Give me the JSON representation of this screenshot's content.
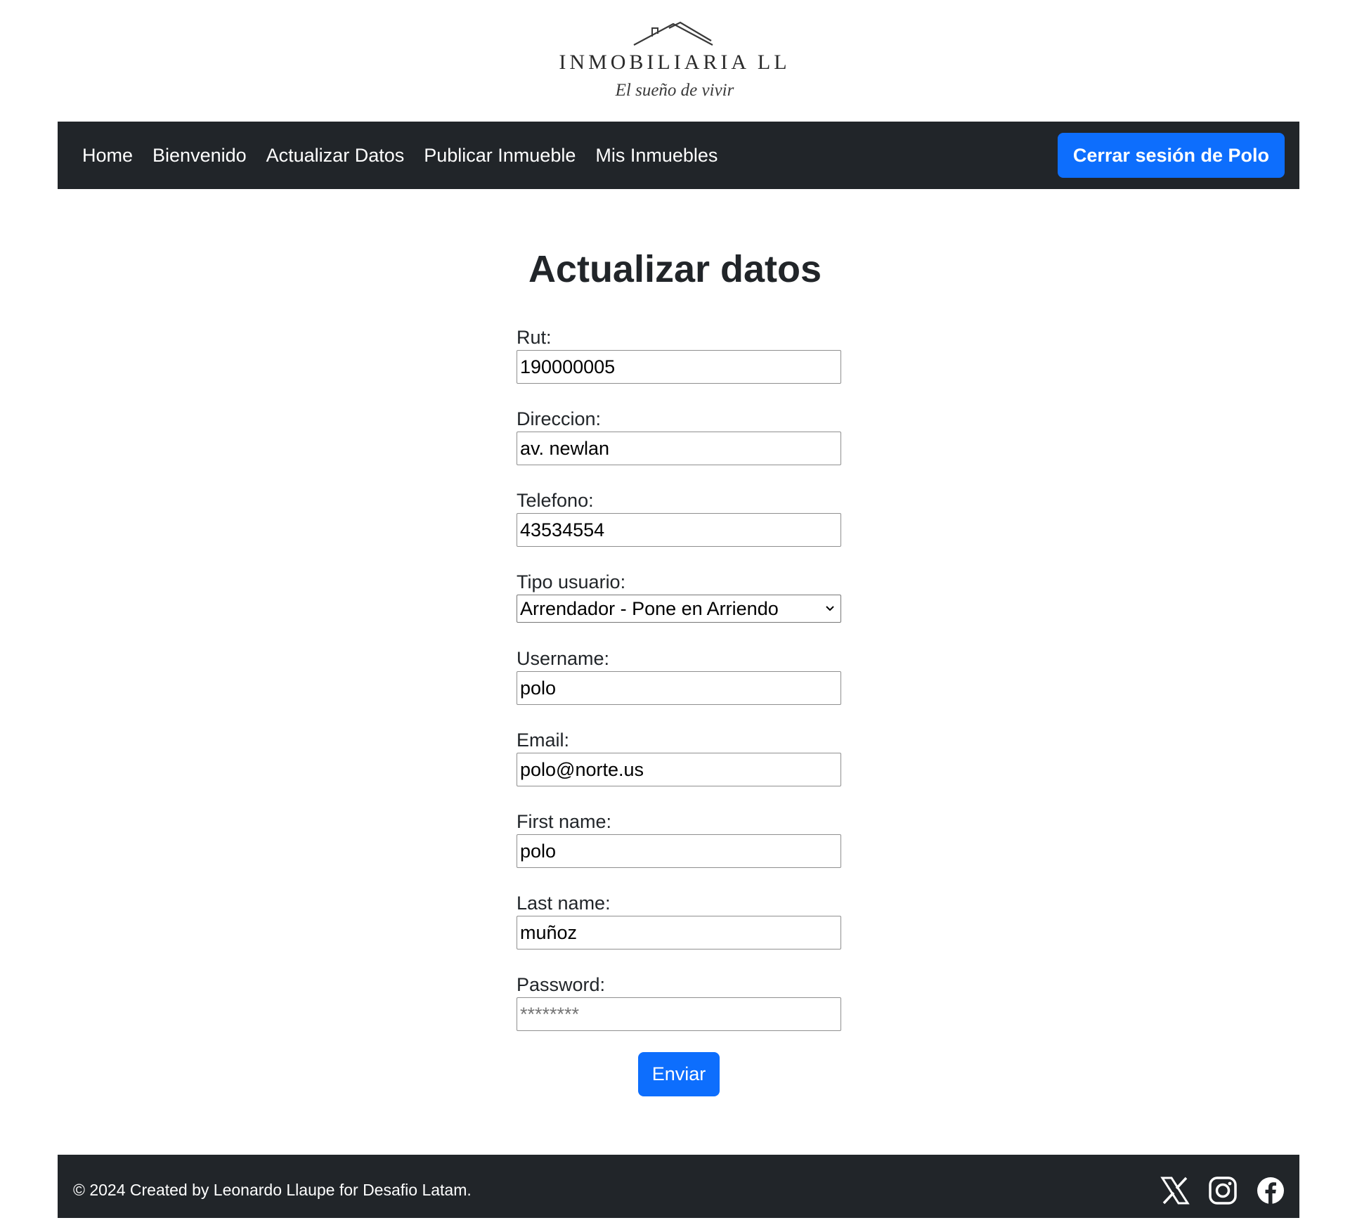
{
  "brand": {
    "name": "INMOBILIARIA LL",
    "tagline": "El sueño de vivir"
  },
  "nav": {
    "items": [
      {
        "label": "Home"
      },
      {
        "label": "Bienvenido"
      },
      {
        "label": "Actualizar Datos"
      },
      {
        "label": "Publicar Inmueble"
      },
      {
        "label": "Mis Inmuebles"
      }
    ],
    "logout_label": "Cerrar sesión de Polo"
  },
  "page": {
    "title": "Actualizar datos"
  },
  "form": {
    "rut": {
      "label": "Rut:",
      "value": "190000005"
    },
    "direccion": {
      "label": "Direccion:",
      "value": "av. newlan"
    },
    "telefono": {
      "label": "Telefono:",
      "value": "43534554"
    },
    "tipo_usuario": {
      "label": "Tipo usuario:",
      "selected": "Arrendador - Pone en Arriendo"
    },
    "username": {
      "label": "Username:",
      "value": "polo"
    },
    "email": {
      "label": "Email:",
      "value": "polo@norte.us"
    },
    "first_name": {
      "label": "First name:",
      "value": "polo"
    },
    "last_name": {
      "label": "Last name:",
      "value": "muñoz"
    },
    "password": {
      "label": "Password:",
      "placeholder": "********"
    },
    "submit_label": "Enviar"
  },
  "footer": {
    "text": "© 2024 Created by Leonardo Llaupe for Desafio Latam.",
    "social_icons": [
      "x-icon",
      "instagram-icon",
      "facebook-icon"
    ]
  },
  "colors": {
    "navbar_bg": "#212529",
    "primary": "#0d6efd",
    "text": "#212529"
  }
}
